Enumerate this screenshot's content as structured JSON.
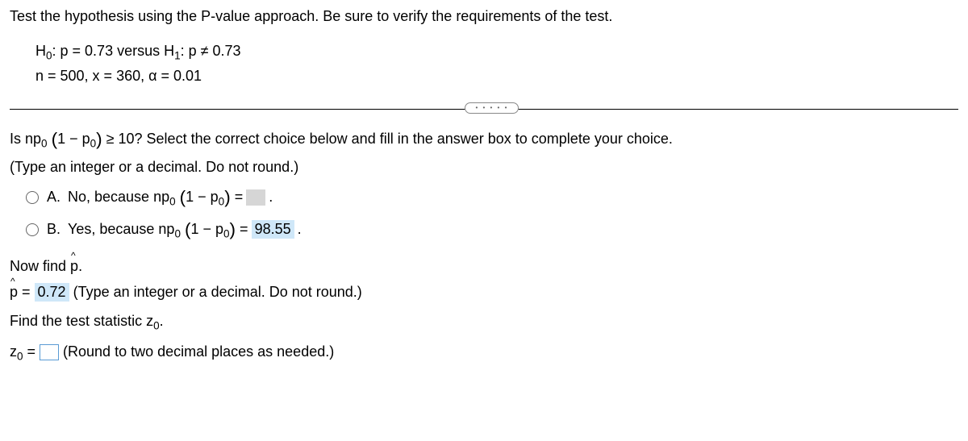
{
  "intro": "Test the hypothesis using the P-value approach. Be sure to verify the requirements of the test.",
  "hypothesis": {
    "h0_label": "H",
    "h0_sub": "0",
    "h0_text": ": p = 0.73 versus H",
    "h1_sub": "1",
    "h1_text": ": p ≠ 0.73",
    "params": "n = 500, x = 360, α = 0.01"
  },
  "divider_dots": "• • • • •",
  "q1": {
    "prefix": "Is np",
    "sub0": "0",
    "paren_open": "(",
    "inner1": "1 − p",
    "sub0b": "0",
    "paren_close": ")",
    "tail": " ≥ 10? Select the correct choice below and fill in the answer box to complete your choice."
  },
  "instruction1": "(Type an integer or a decimal. Do not round.)",
  "choiceA": {
    "label": "A.",
    "text1": "No, because np",
    "sub": "0",
    "paren_open": "(",
    "inner": "1 − p",
    "sub2": "0",
    "paren_close": ")",
    "eq": " = ",
    "period": " ."
  },
  "choiceB": {
    "label": "B.",
    "text1": "Yes, because np",
    "sub": "0",
    "paren_open": "(",
    "inner": "1 − p",
    "sub2": "0",
    "paren_close": ")",
    "eq": " = ",
    "value": "98.55",
    "period": " ."
  },
  "section_phat": {
    "prefix": "Now find ",
    "p": "p",
    "hat": "^",
    "period": "."
  },
  "phat_answer": {
    "p": "p",
    "hat": "^",
    "eq": " = ",
    "value": "0.72",
    "tail": "  (Type an integer or a decimal. Do not round.)"
  },
  "section_z": {
    "text": "Find the test statistic z",
    "sub": "0",
    "period": "."
  },
  "z_answer": {
    "z": "z",
    "sub": "0",
    "eq": " = ",
    "tail": " (Round to two decimal places as needed.)"
  }
}
